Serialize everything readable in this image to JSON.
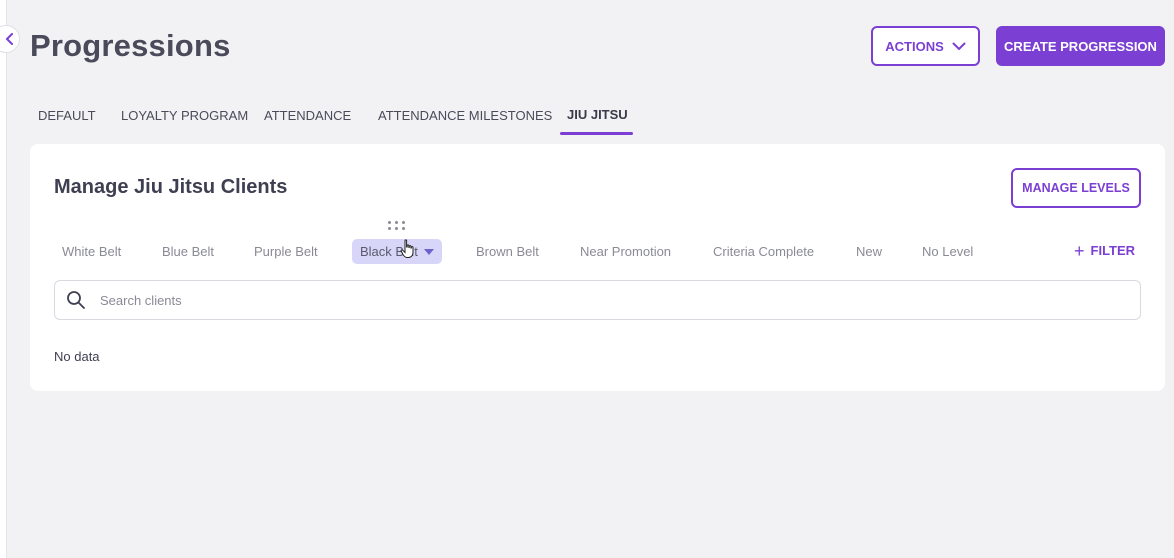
{
  "header": {
    "title": "Progressions",
    "actions_label": "ACTIONS",
    "create_label": "CREATE PROGRESSION"
  },
  "tabs": [
    {
      "label": "DEFAULT",
      "active": false
    },
    {
      "label": "LOYALTY PROGRAM",
      "active": false
    },
    {
      "label": "ATTENDANCE",
      "active": false
    },
    {
      "label": "ATTENDANCE MILESTONES",
      "active": false
    },
    {
      "label": "JIU JITSU",
      "active": true
    }
  ],
  "card": {
    "title": "Manage Jiu Jitsu Clients",
    "manage_levels_label": "MANAGE LEVELS",
    "filter_label": "FILTER",
    "levels": [
      {
        "label": "White Belt",
        "active": false
      },
      {
        "label": "Blue Belt",
        "active": false
      },
      {
        "label": "Purple Belt",
        "active": false
      },
      {
        "label": "Black Belt",
        "active": true
      },
      {
        "label": "Brown Belt",
        "active": false
      },
      {
        "label": "Near Promotion",
        "active": false
      },
      {
        "label": "Criteria Complete",
        "active": false
      },
      {
        "label": "New",
        "active": false
      },
      {
        "label": "No Level",
        "active": false
      }
    ],
    "search": {
      "placeholder": "Search clients",
      "value": ""
    },
    "empty_text": "No data"
  },
  "colors": {
    "accent": "#7b3fd3",
    "active_level_bg": "#d8d6f8",
    "page_bg": "#f2f2f5"
  },
  "icons": {
    "collapse": "chevron-left-icon",
    "actions_caret": "chevron-down-icon",
    "search": "search-icon",
    "drag": "drag-handle-icon",
    "cursor": "hand-cursor-icon",
    "filter": "plus-icon"
  }
}
